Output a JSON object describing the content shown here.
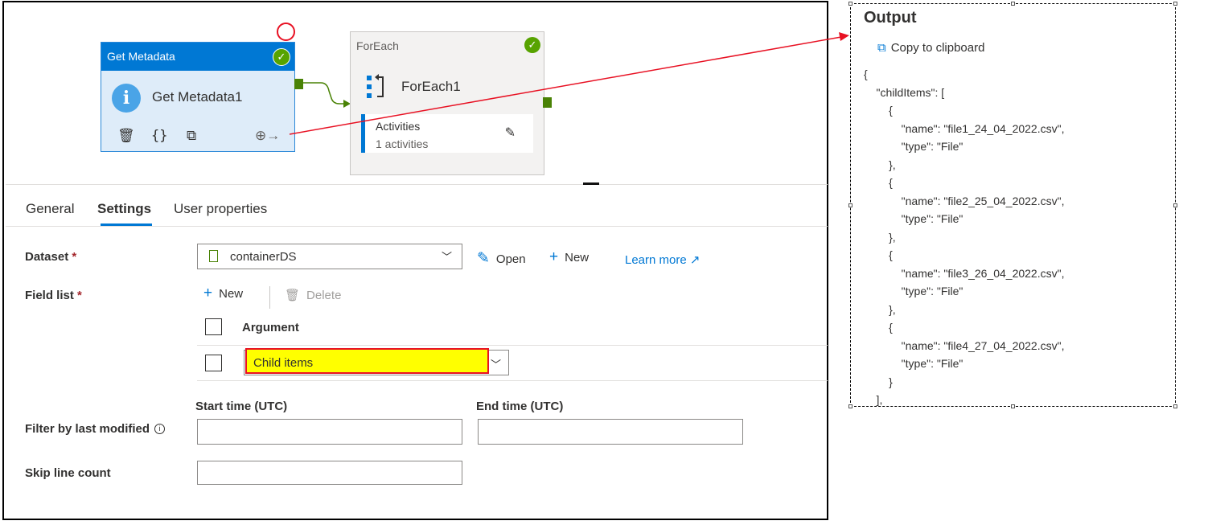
{
  "canvas": {
    "get_metadata": {
      "header": "Get Metadata",
      "name": "Get Metadata1"
    },
    "foreach": {
      "header": "ForEach",
      "name": "ForEach1",
      "activities_label": "Activities",
      "activities_count": "1 activities"
    }
  },
  "tabs": [
    "General",
    "Settings",
    "User properties"
  ],
  "settings": {
    "dataset_label": "Dataset",
    "required_mark": "*",
    "dataset_value": "containerDS",
    "open_label": "Open",
    "new_label": "New",
    "learn_more_label": "Learn more",
    "field_list_label": "Field list",
    "field_new_label": "New",
    "field_delete_label": "Delete",
    "argument_header": "Argument",
    "argument_value": "Child items",
    "start_time_label": "Start time (UTC)",
    "end_time_label": "End time (UTC)",
    "filter_label": "Filter by last modified",
    "skip_line_label": "Skip line count"
  },
  "output": {
    "title": "Output",
    "copy_label": "Copy to clipboard",
    "json_text": "{\n    \"childItems\": [\n        {\n            \"name\": \"file1_24_04_2022.csv\",\n            \"type\": \"File\"\n        },\n        {\n            \"name\": \"file2_25_04_2022.csv\",\n            \"type\": \"File\"\n        },\n        {\n            \"name\": \"file3_26_04_2022.csv\",\n            \"type\": \"File\"\n        },\n        {\n            \"name\": \"file4_27_04_2022.csv\",\n            \"type\": \"File\"\n        }\n    ],"
  },
  "colors": {
    "accent": "#0078d4",
    "success": "#57a300",
    "port": "#498205",
    "highlight": "#ffff00",
    "annotation": "#e81123"
  },
  "icons": [
    "info-icon",
    "check-icon",
    "trash-icon",
    "code-braces-icon",
    "copy-icon",
    "add-output-icon",
    "foreach-icon",
    "pencil-icon",
    "dataset-file-icon",
    "chevron-down-icon",
    "plus-icon",
    "external-link-icon",
    "info-small-icon",
    "clipboard-icon"
  ]
}
